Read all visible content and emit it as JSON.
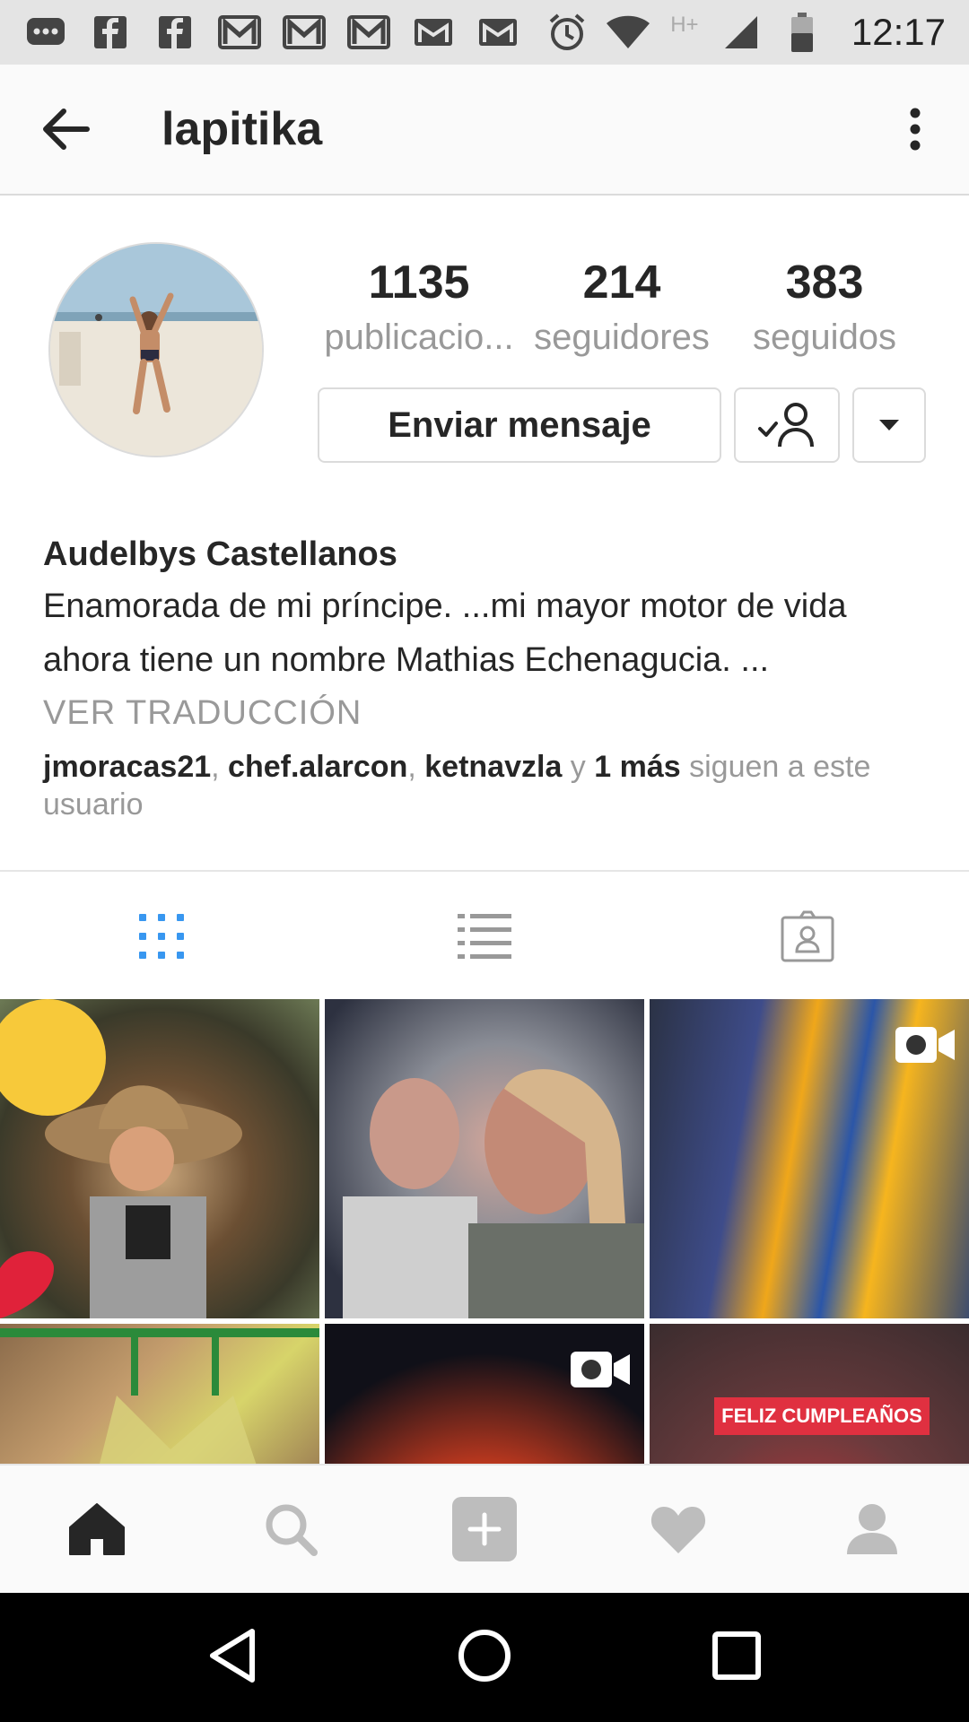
{
  "status_bar": {
    "time": "12:17",
    "network": "H+",
    "notification_icons": [
      "chat-icon",
      "facebook-icon",
      "facebook-icon",
      "gmail-icon",
      "gmail-icon",
      "gmail-icon",
      "mail-icon",
      "mail-icon"
    ],
    "system_icons": [
      "alarm-icon",
      "wifi-icon",
      "signal-icon",
      "battery-icon"
    ]
  },
  "header": {
    "username": "lapitika",
    "back_icon": "arrow-left-icon",
    "menu_icon": "more-vert-icon"
  },
  "profile": {
    "stats": [
      {
        "value": "1135",
        "label": "publicacio..."
      },
      {
        "value": "214",
        "label": "seguidores"
      },
      {
        "value": "383",
        "label": "seguidos"
      }
    ],
    "message_button": "Enviar mensaje",
    "name": "Audelbys Castellanos",
    "bio": "Enamorada de mi príncipe. ...mi mayor motor de vida ahora tiene un nombre Mathias Echenagucia. ...",
    "translate": "VER TRADUCCIÓN",
    "followed_by": {
      "user1": "jmoracas21",
      "sep1": ", ",
      "user2": "chef.alarcon",
      "sep2": ", ",
      "user3": "ketnavzla",
      "and": " y ",
      "more": "1 más",
      "suffix": " siguen a este usuario"
    }
  },
  "tabs": [
    "grid-icon",
    "list-icon",
    "tagged-icon"
  ],
  "grid": {
    "banner_text": "FELIZ CUMPLEAÑOS"
  },
  "bottom_nav": [
    "home-icon",
    "search-icon",
    "add-icon",
    "heart-icon",
    "profile-icon"
  ],
  "colors": {
    "active_tab": "#3897f0",
    "text_primary": "#262626",
    "text_secondary": "#999999",
    "border": "#dbdbdb"
  }
}
